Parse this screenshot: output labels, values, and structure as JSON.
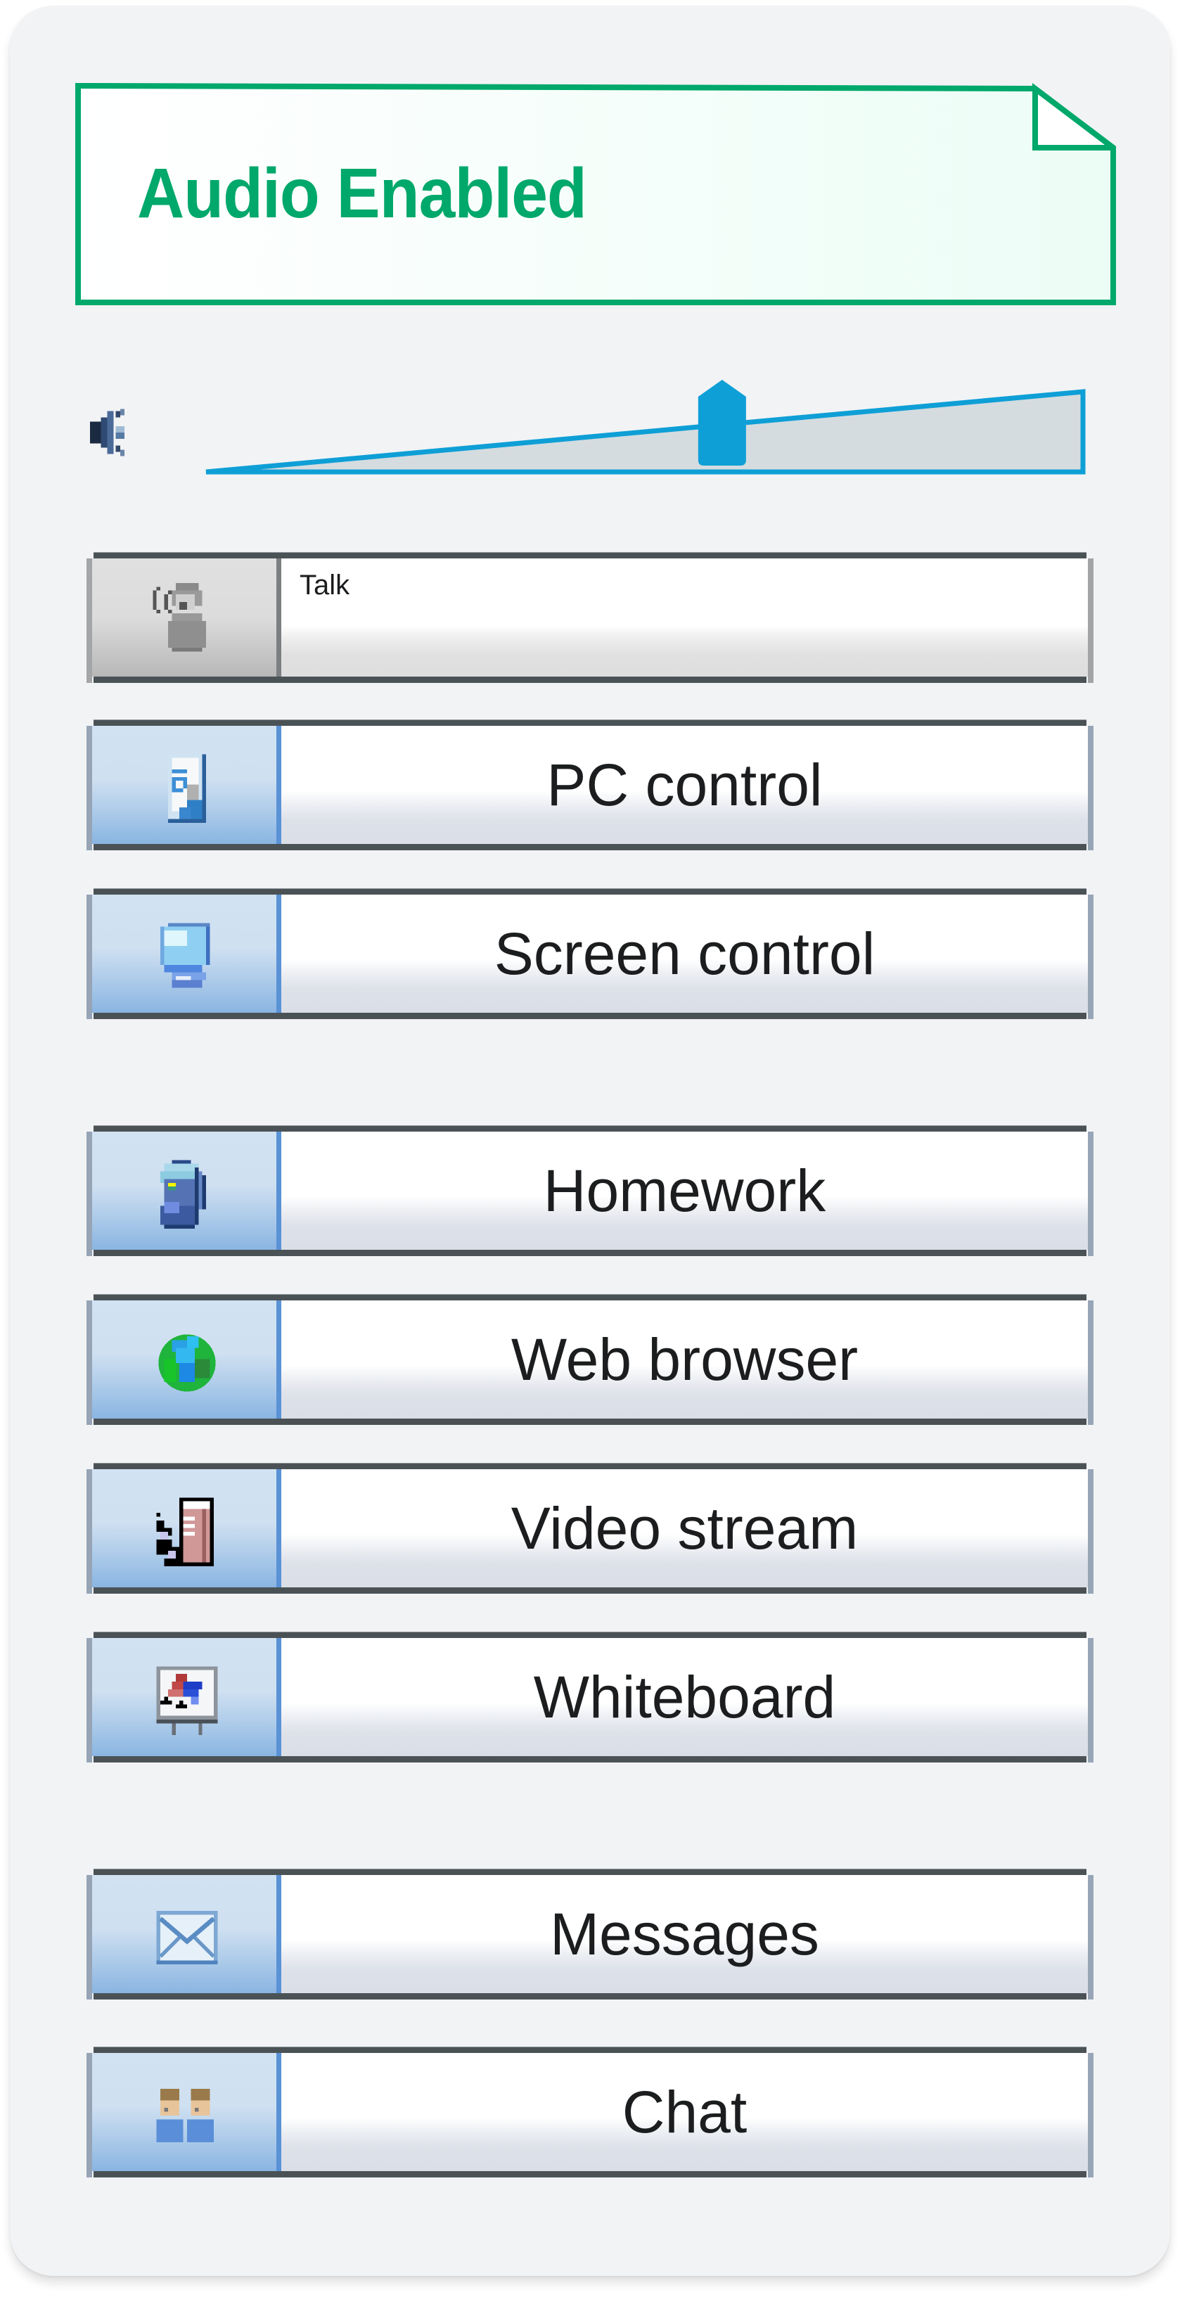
{
  "header": {
    "title": "Audio Enabled",
    "accent_color": "#00a86b"
  },
  "volume": {
    "icon": "speaker-icon",
    "level_percent": 55,
    "accent_color": "#0e9fd6"
  },
  "buttons": [
    {
      "id": "talk",
      "label": "Talk",
      "icon": "talk-person-icon",
      "state": "disabled"
    },
    {
      "id": "pc-control",
      "label": "PC control",
      "icon": "document-icon",
      "state": "enabled"
    },
    {
      "id": "screen-control",
      "label": "Screen control",
      "icon": "monitor-icon",
      "state": "enabled"
    },
    {
      "id": "homework",
      "label": "Homework",
      "icon": "backpack-icon",
      "state": "enabled"
    },
    {
      "id": "web-browser",
      "label": "Web browser",
      "icon": "globe-icon",
      "state": "enabled"
    },
    {
      "id": "video-stream",
      "label": "Video stream",
      "icon": "video-stream-icon",
      "state": "enabled"
    },
    {
      "id": "whiteboard",
      "label": "Whiteboard",
      "icon": "whiteboard-icon",
      "state": "enabled"
    },
    {
      "id": "messages",
      "label": "Messages",
      "icon": "envelope-icon",
      "state": "enabled"
    },
    {
      "id": "chat",
      "label": "Chat",
      "icon": "users-icon",
      "state": "enabled"
    }
  ]
}
